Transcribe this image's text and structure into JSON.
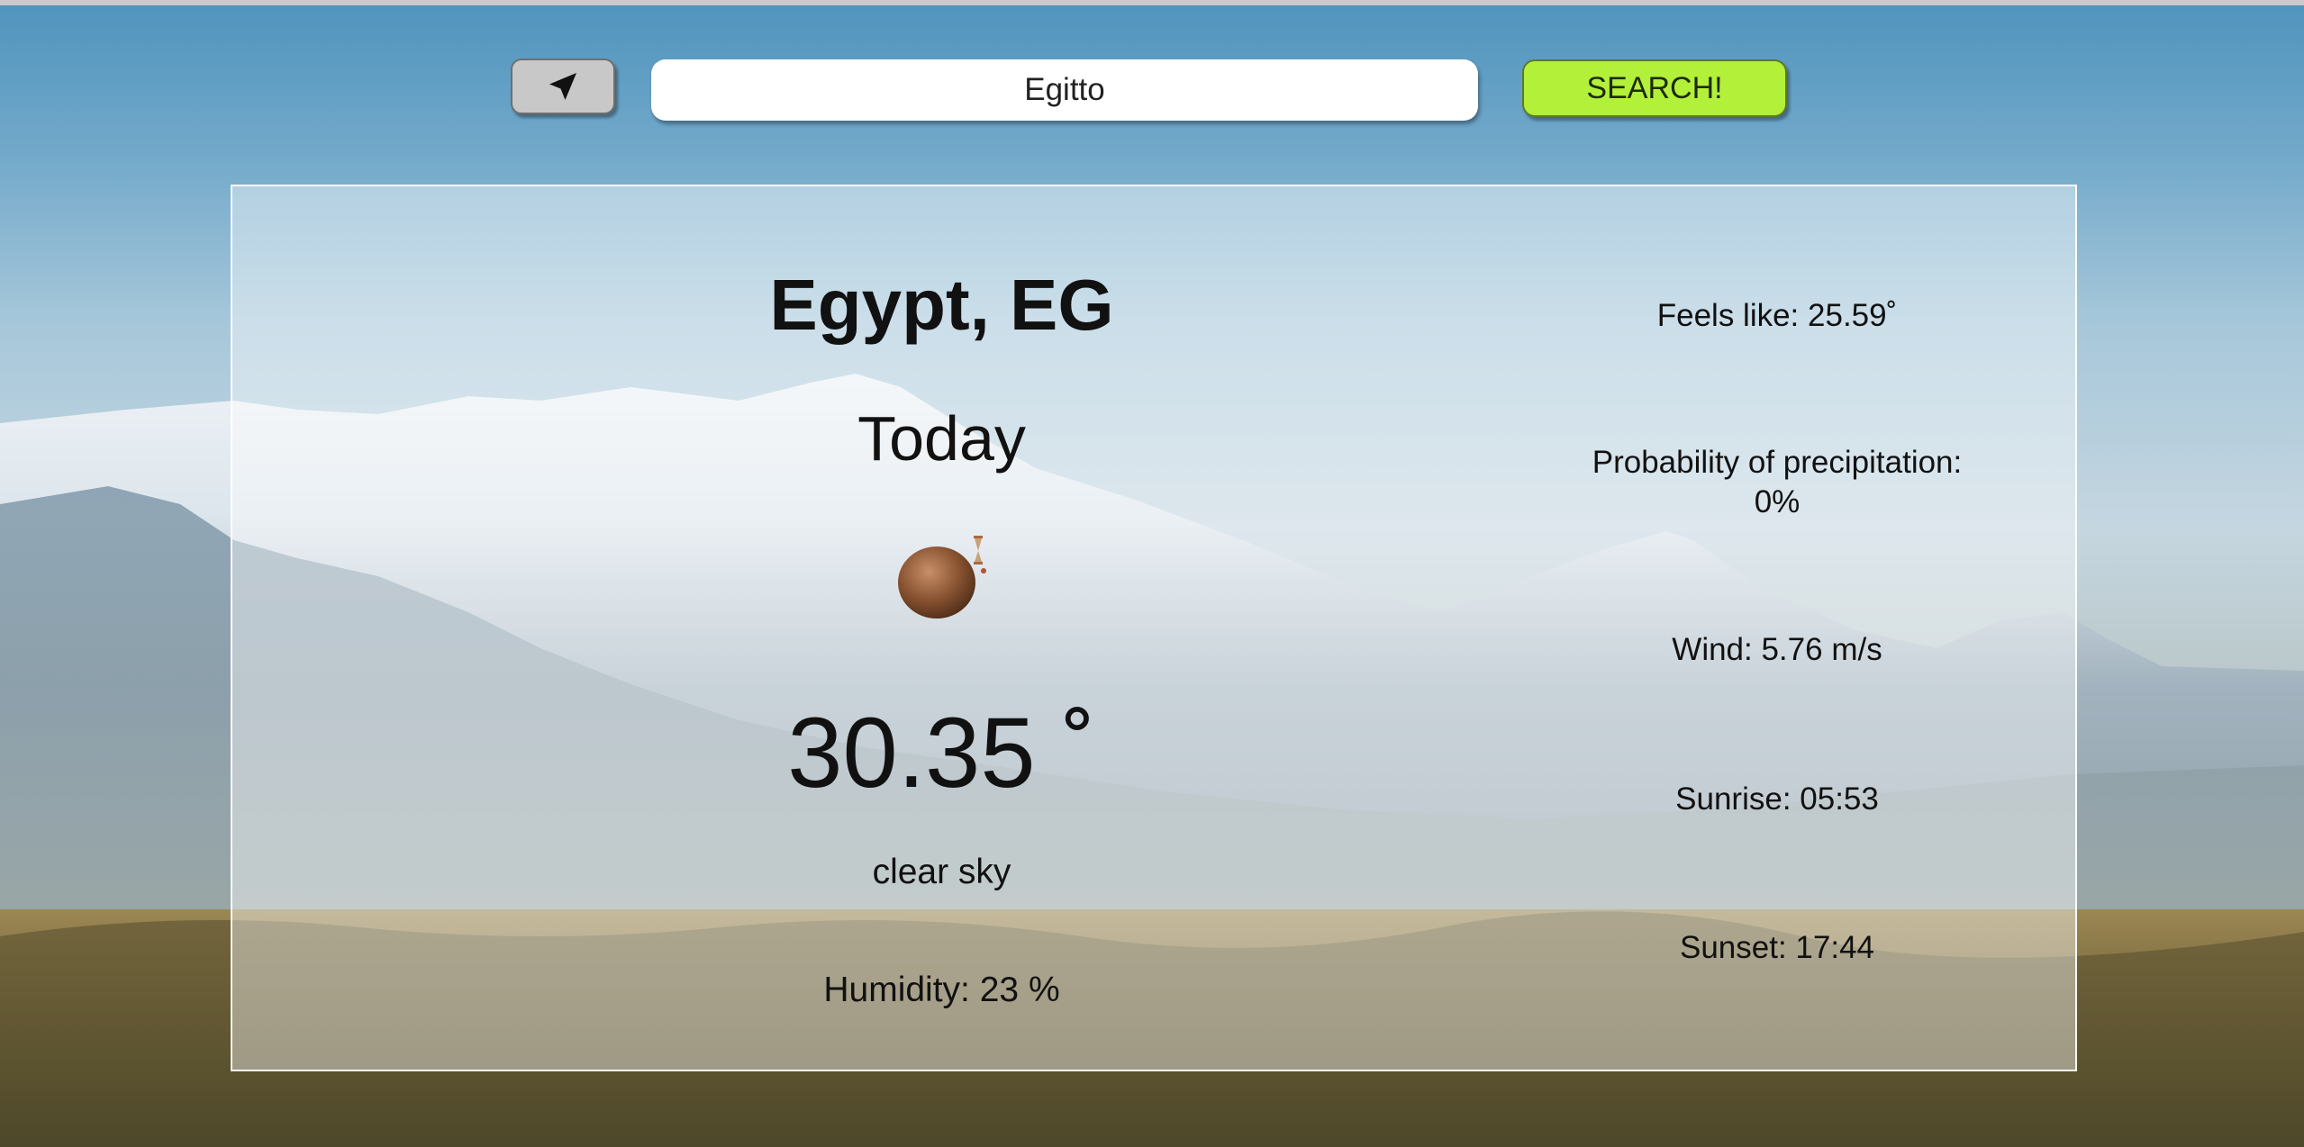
{
  "search": {
    "value": "Egitto",
    "button_label": "SEARCH!"
  },
  "locate_button": {
    "icon": "navigation-arrow-icon"
  },
  "weather": {
    "location": "Egypt, EG",
    "day": "Today",
    "icon": "brown-ball-weather-icon",
    "temperature": "30.35 ˚",
    "description": "clear sky",
    "humidity": "Humidity: 23 %"
  },
  "details": {
    "feels_like": "Feels like: 25.59˚",
    "precipitation_label": "Probability of precipitation:",
    "precipitation_value": "0%",
    "wind": "Wind: 5.76 m/s",
    "sunrise": "Sunrise: 05:53",
    "sunset": "Sunset: 17:44"
  },
  "colors": {
    "search_button": "#b2f03a",
    "locate_button": "#c8c8c8"
  }
}
